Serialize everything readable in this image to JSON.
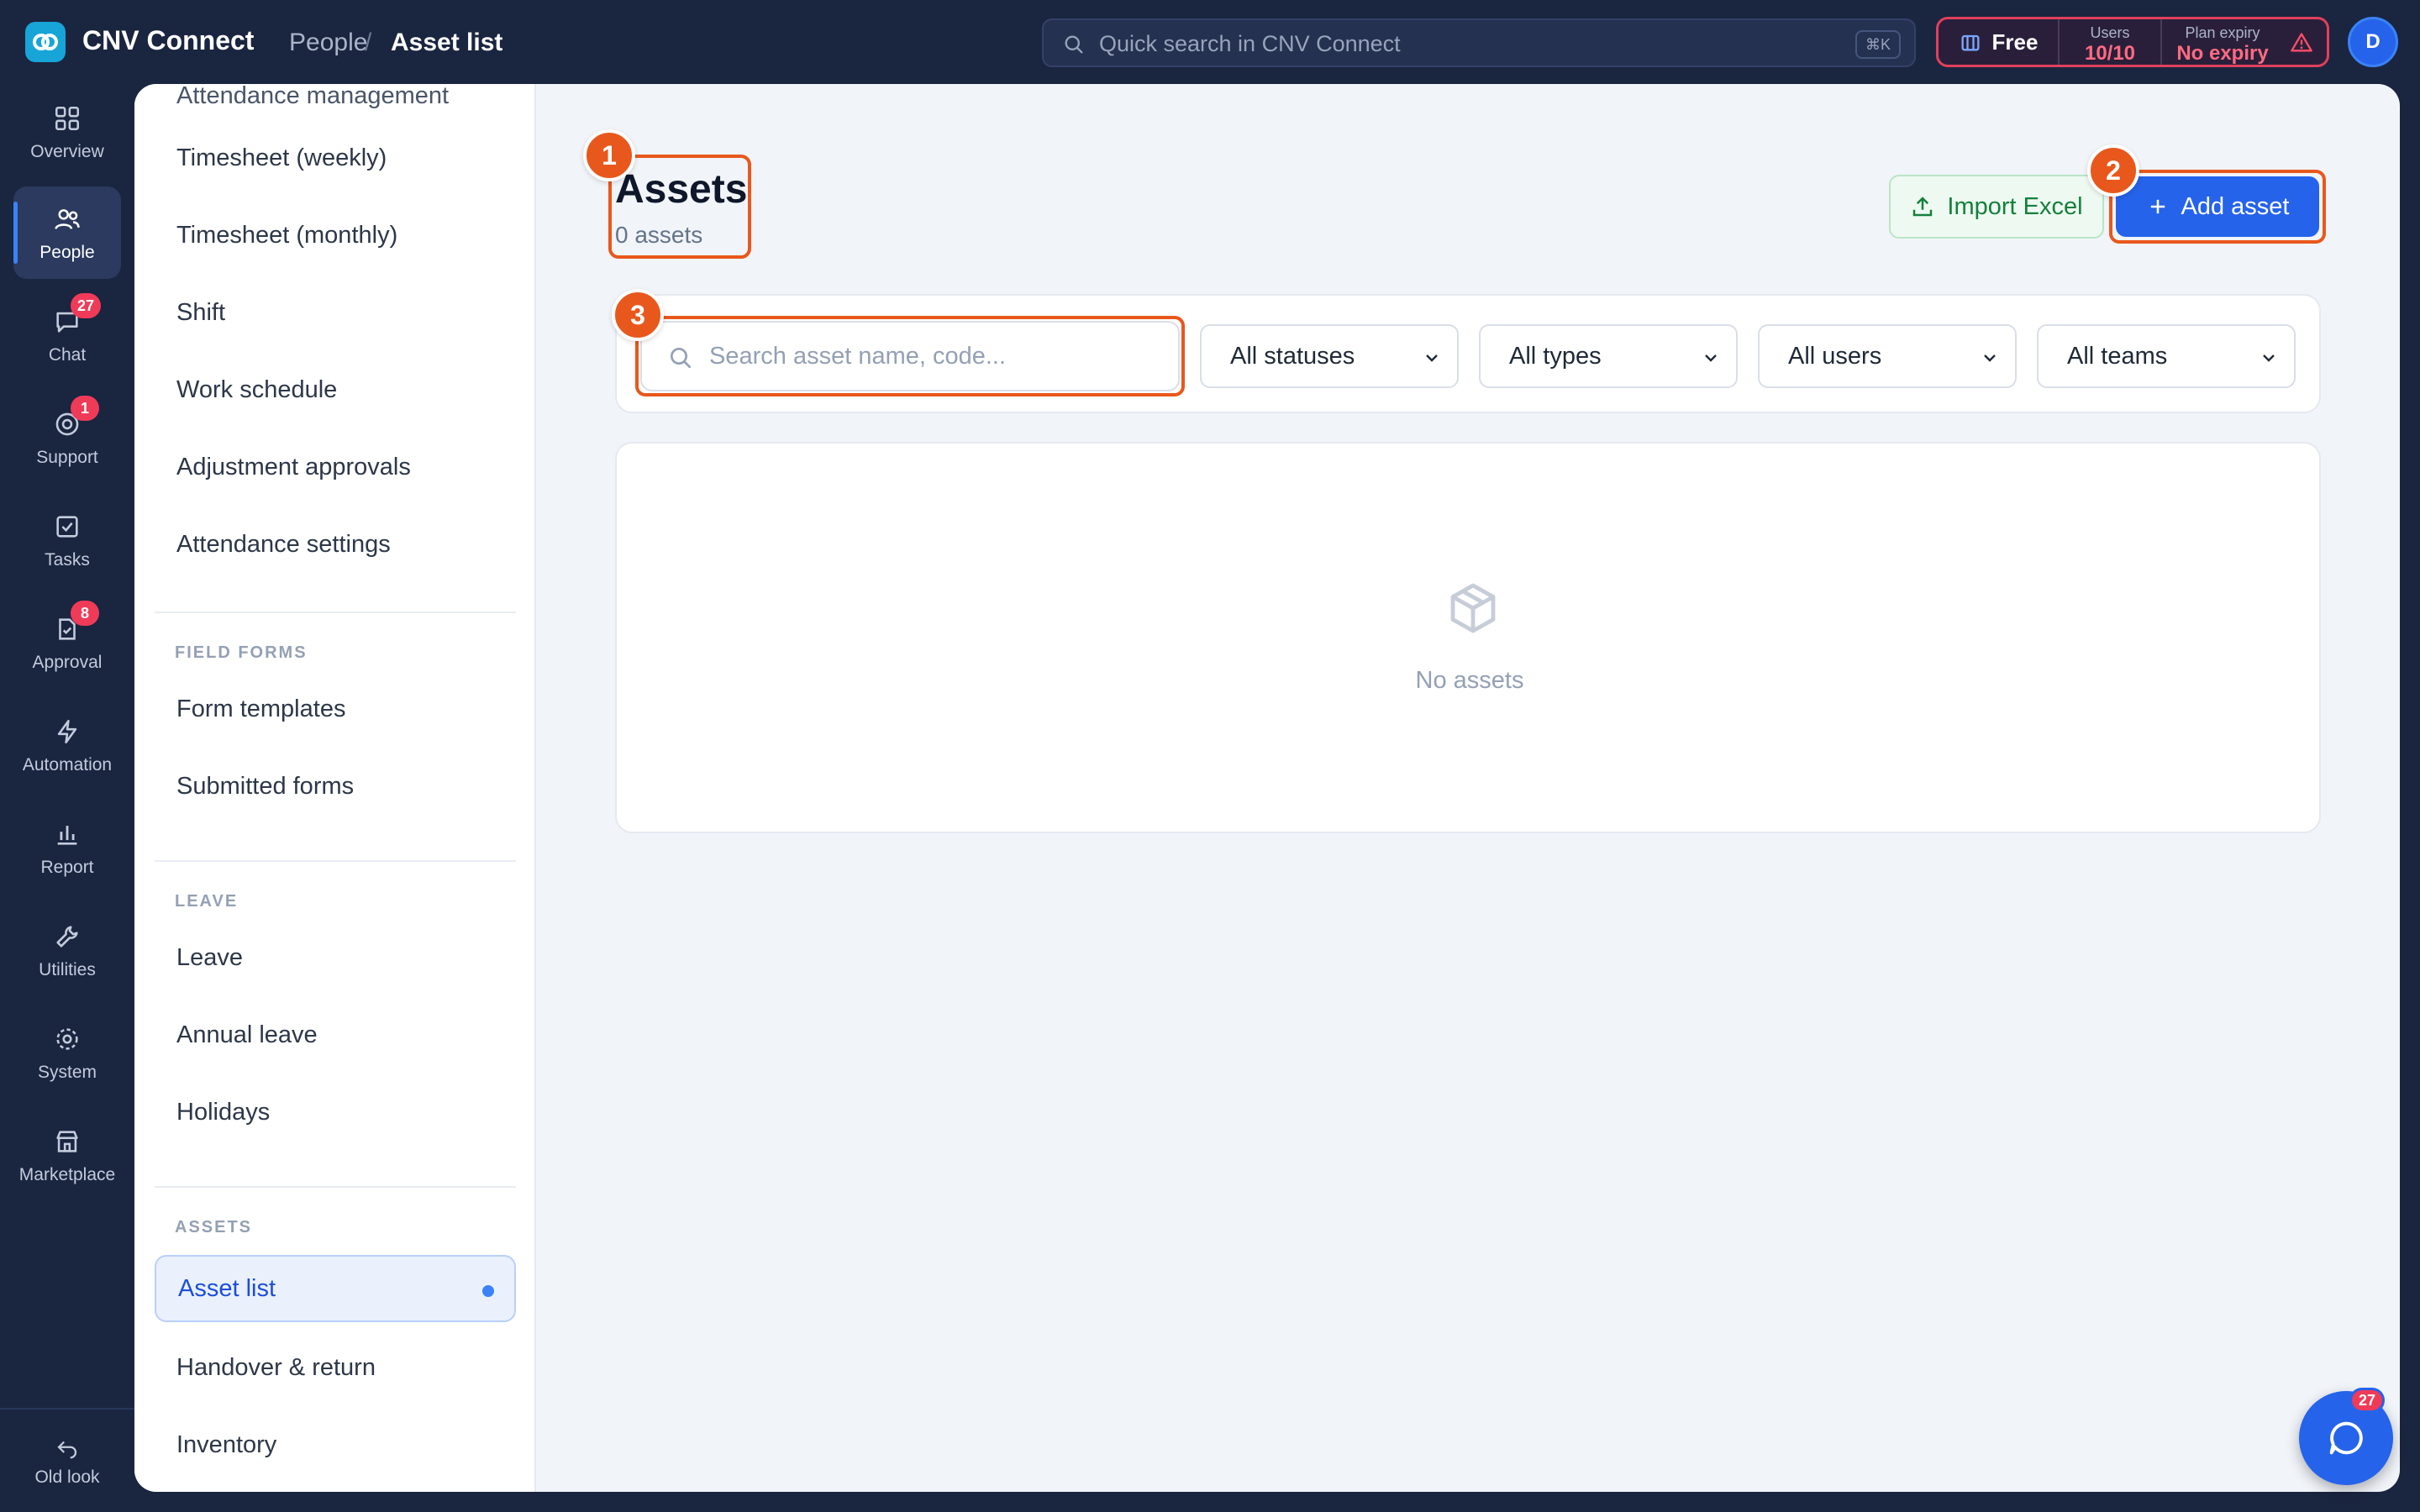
{
  "app": {
    "name": "CNV Connect"
  },
  "breadcrumb": {
    "section": "People",
    "separator": "/",
    "page": "Asset list"
  },
  "search": {
    "placeholder": "Quick search in CNV Connect",
    "shortcut": "⌘K"
  },
  "plan": {
    "name": "Free",
    "users_label": "Users",
    "users_value": "10/10",
    "expiry_label": "Plan expiry",
    "expiry_value": "No expiry"
  },
  "user": {
    "avatar_initial": "D"
  },
  "rail": {
    "items": [
      {
        "label": "Overview",
        "icon": "grid-icon"
      },
      {
        "label": "People",
        "icon": "people-icon",
        "active": true
      },
      {
        "label": "Chat",
        "icon": "chat-icon",
        "badge": "27"
      },
      {
        "label": "Support",
        "icon": "support-icon",
        "badge": "1"
      },
      {
        "label": "Tasks",
        "icon": "check-square-icon"
      },
      {
        "label": "Approval",
        "icon": "approval-icon",
        "badge": "8"
      },
      {
        "label": "Automation",
        "icon": "lightning-icon"
      },
      {
        "label": "Report",
        "icon": "bar-chart-icon"
      },
      {
        "label": "Utilities",
        "icon": "wrench-icon"
      },
      {
        "label": "System",
        "icon": "gear-icon"
      },
      {
        "label": "Marketplace",
        "icon": "store-icon"
      }
    ],
    "old_look": "Old look"
  },
  "subnav": {
    "top_partial": "Attendance management",
    "items_attendance": [
      "Timesheet (weekly)",
      "Timesheet (monthly)",
      "Shift",
      "Work schedule",
      "Adjustment approvals",
      "Attendance settings"
    ],
    "field_forms_heading": "FIELD FORMS",
    "items_field_forms": [
      "Form templates",
      "Submitted forms"
    ],
    "leave_heading": "LEAVE",
    "items_leave": [
      "Leave",
      "Annual leave",
      "Holidays"
    ],
    "assets_heading": "ASSETS",
    "items_assets": [
      "Asset list",
      "Handover & return",
      "Inventory"
    ]
  },
  "page": {
    "title": "Assets",
    "count": "0 assets",
    "import_button": "Import Excel",
    "add_button": "Add asset"
  },
  "filters": {
    "search_placeholder": "Search asset name, code...",
    "status": "All statuses",
    "type": "All types",
    "users": "All users",
    "teams": "All teams"
  },
  "empty_state": {
    "text": "No assets"
  },
  "markers": [
    "1",
    "2",
    "3"
  ],
  "chat_fab": {
    "badge": "27"
  },
  "colors": {
    "accent": "#2563eb",
    "highlight": "#e8581c",
    "sidebar_bg": "#1a2540",
    "badge": "#ef3b58"
  }
}
